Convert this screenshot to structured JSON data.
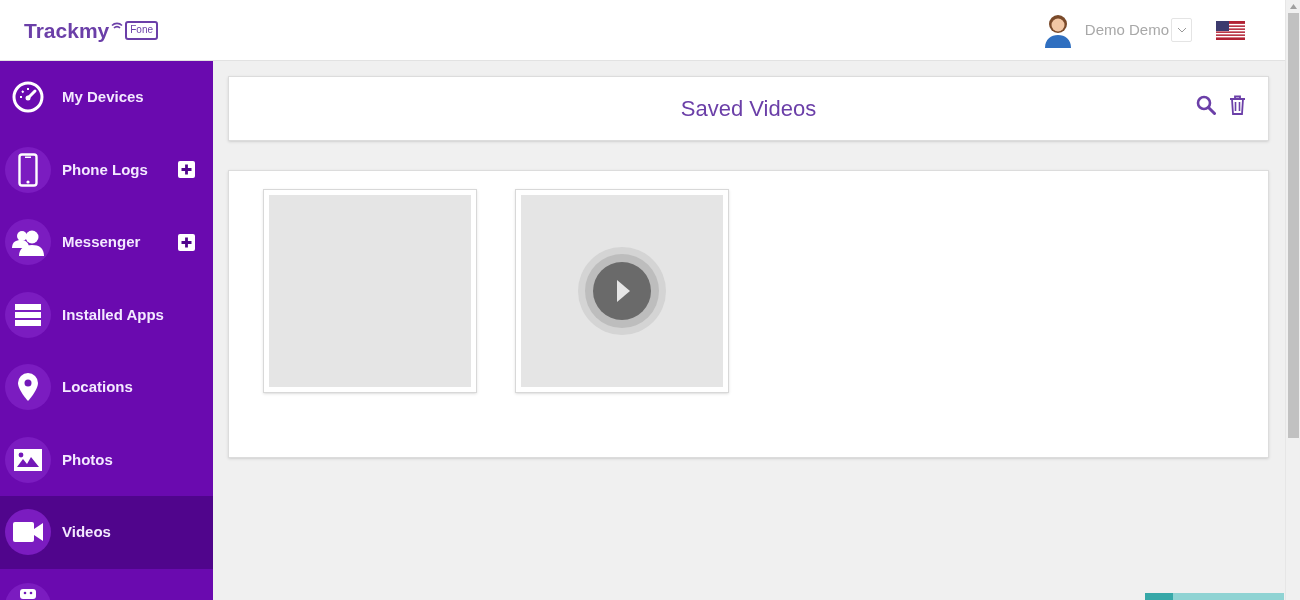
{
  "header": {
    "logo": {
      "word": "Trackmy",
      "badge": "Fone"
    },
    "user": {
      "name": "Demo Demo"
    }
  },
  "sidebar": {
    "items": [
      {
        "label": "My Devices",
        "selected": false,
        "expandable": false
      },
      {
        "label": "Phone Logs",
        "selected": false,
        "expandable": true
      },
      {
        "label": "Messenger",
        "selected": false,
        "expandable": true
      },
      {
        "label": "Installed Apps",
        "selected": false,
        "expandable": false
      },
      {
        "label": "Locations",
        "selected": false,
        "expandable": false
      },
      {
        "label": "Photos",
        "selected": false,
        "expandable": false
      },
      {
        "label": "Videos",
        "selected": true,
        "expandable": false
      },
      {
        "selected": false,
        "expandable": false
      }
    ]
  },
  "page": {
    "title": "Saved Videos"
  },
  "videos": [
    {
      "play_button": false
    },
    {
      "play_button": true
    }
  ]
}
